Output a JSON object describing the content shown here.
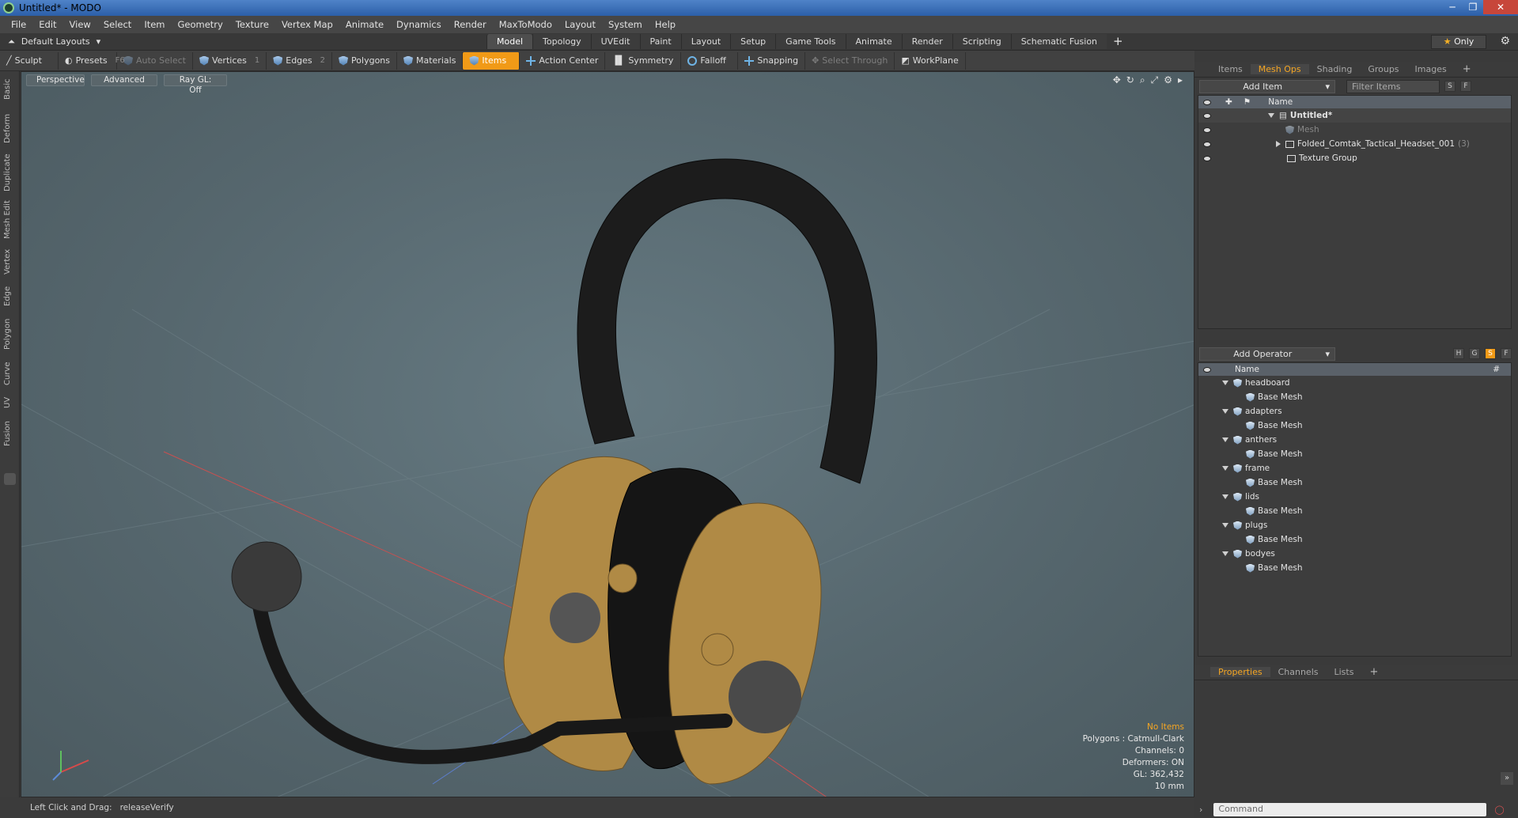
{
  "window": {
    "title": "Untitled* - MODO"
  },
  "menu": [
    "File",
    "Edit",
    "View",
    "Select",
    "Item",
    "Geometry",
    "Texture",
    "Vertex Map",
    "Animate",
    "Dynamics",
    "Render",
    "MaxToModo",
    "Layout",
    "System",
    "Help"
  ],
  "layout": {
    "selector": "Default Layouts",
    "tabs": [
      "Model",
      "Topology",
      "UVEdit",
      "Paint",
      "Layout",
      "Setup",
      "Game Tools",
      "Animate",
      "Render",
      "Scripting",
      "Schematic Fusion"
    ],
    "active_tab": "Model",
    "only_label": "Only"
  },
  "toolbar": {
    "sculpt": "Sculpt",
    "presets": "Presets",
    "presets_key": "F6",
    "auto_select": "Auto Select",
    "vertices": "Vertices",
    "vertices_key": "1",
    "edges": "Edges",
    "edges_key": "2",
    "polygons": "Polygons",
    "materials": "Materials",
    "items": "Items",
    "action_center": "Action Center",
    "symmetry": "Symmetry",
    "falloff": "Falloff",
    "snapping": "Snapping",
    "select_through": "Select Through",
    "workplane": "WorkPlane"
  },
  "left_tabs": [
    "Basic",
    "Deform",
    "Duplicate",
    "Mesh Edit",
    "Vertex",
    "Edge",
    "Polygon",
    "Curve",
    "UV",
    "Fusion"
  ],
  "viewport": {
    "view": "Perspective",
    "mode": "Advanced",
    "raygl": "Ray GL: Off",
    "info": {
      "no_items": "No Items",
      "polygons": "Polygons : Catmull-Clark",
      "channels": "Channels: 0",
      "deformers": "Deformers: ON",
      "gl": "GL: 362,432",
      "scale": "10 mm"
    }
  },
  "status": {
    "left": "Left Click and Drag:",
    "action": "releaseVerify"
  },
  "items_panel": {
    "tabs": [
      "Items",
      "Mesh Ops",
      "Shading",
      "Groups",
      "Images"
    ],
    "active_tab": "Mesh Ops",
    "add_item": "Add Item",
    "filter_placeholder": "Filter Items",
    "col_name": "Name",
    "rows": [
      {
        "label": "Untitled*",
        "sub": ""
      },
      {
        "label": "Mesh",
        "sub": ""
      },
      {
        "label": "Folded_Comtak_Tactical_Headset_001",
        "sub": "(3)"
      },
      {
        "label": "Texture Group",
        "sub": ""
      }
    ]
  },
  "ops_panel": {
    "add_operator": "Add Operator",
    "col_name": "Name",
    "col_hash": "#",
    "groups": [
      {
        "name": "headboard",
        "child": "Base Mesh"
      },
      {
        "name": "adapters",
        "child": "Base Mesh"
      },
      {
        "name": "anthers",
        "child": "Base Mesh"
      },
      {
        "name": "frame",
        "child": "Base Mesh"
      },
      {
        "name": "lids",
        "child": "Base Mesh"
      },
      {
        "name": "plugs",
        "child": "Base Mesh"
      },
      {
        "name": "bodyes",
        "child": "Base Mesh"
      }
    ]
  },
  "props_panel": {
    "tabs": [
      "Properties",
      "Channels",
      "Lists"
    ],
    "active_tab": "Properties",
    "command_placeholder": "Command"
  },
  "colors": {
    "accent": "#f19a17",
    "viewport_bg": "#5b6c73",
    "headset_tan": "#b08a45"
  }
}
